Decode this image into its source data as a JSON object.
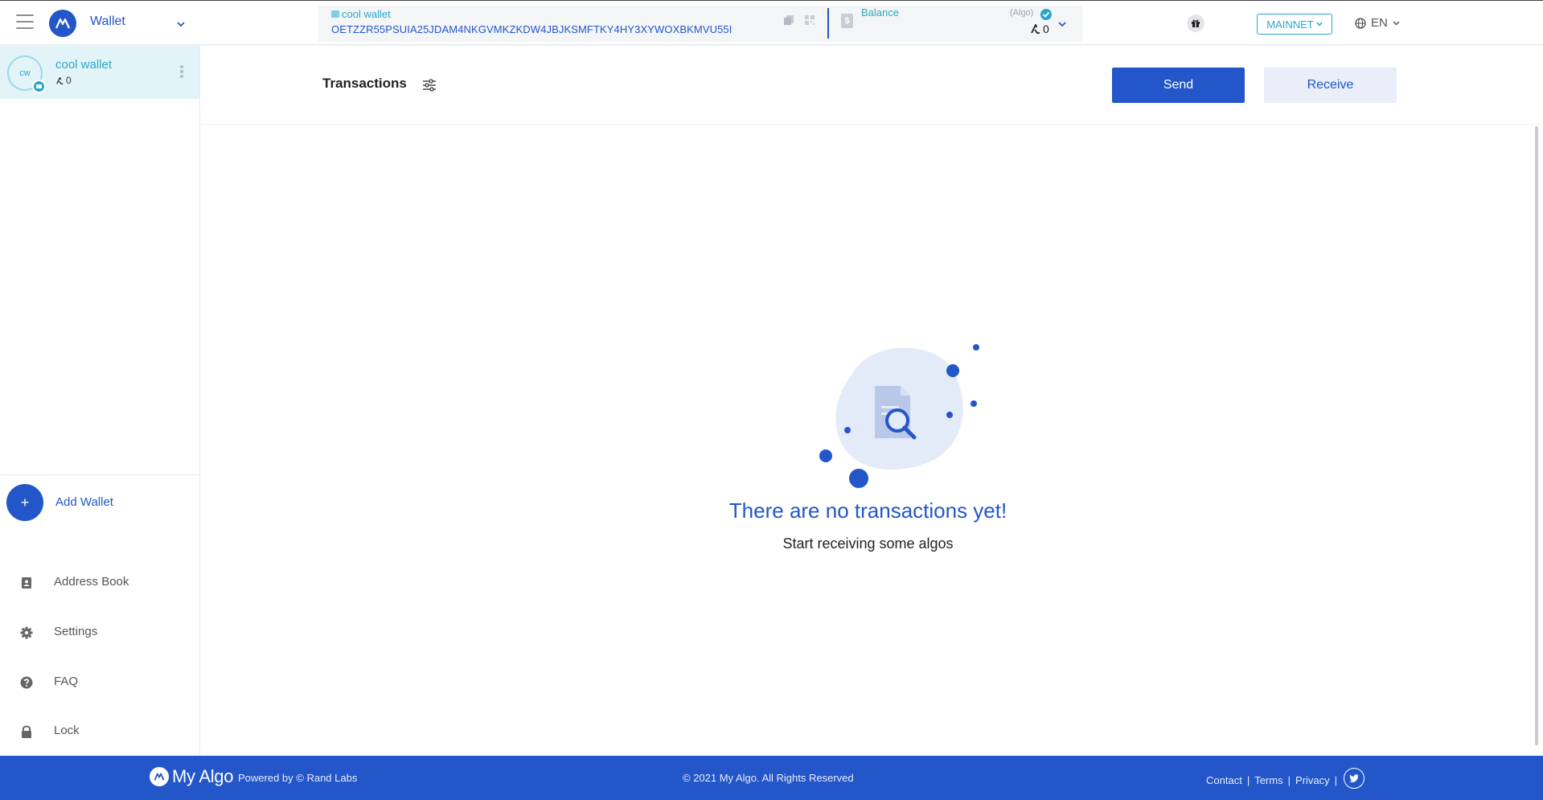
{
  "header": {
    "wallet_menu_label": "Wallet",
    "account_name": "cool wallet",
    "address": "OETZZR55PSUIA25JDAM4NKGVMKZKDW4JBJKSMFTKY4HY3XYWOXBKMVU55I",
    "balance_label": "Balance",
    "balance_unit": "(Algo)",
    "balance_value": "0",
    "network": "MAINNET",
    "language": "EN"
  },
  "sidebar": {
    "wallet": {
      "initials": "cw",
      "name": "cool wallet",
      "balance": "0"
    },
    "add_wallet_label": "Add Wallet",
    "nav": [
      {
        "label": "Address Book",
        "icon": "address-book-icon"
      },
      {
        "label": "Settings",
        "icon": "gear-icon"
      },
      {
        "label": "FAQ",
        "icon": "question-icon"
      },
      {
        "label": "Lock",
        "icon": "lock-icon"
      }
    ]
  },
  "main": {
    "title": "Transactions",
    "send_label": "Send",
    "receive_label": "Receive",
    "empty_title": "There are no transactions yet!",
    "empty_subtitle": "Start receiving some algos"
  },
  "footer": {
    "brand": "My Algo",
    "powered_by": "Powered by  © Rand Labs",
    "copyright": "© 2021 My Algo.  All Rights Reserved",
    "links": [
      "Contact",
      "Terms",
      "Privacy"
    ]
  },
  "colors": {
    "primary": "#2256c9",
    "accent": "#2aa7c9",
    "selected_bg": "#e3f4f9"
  }
}
